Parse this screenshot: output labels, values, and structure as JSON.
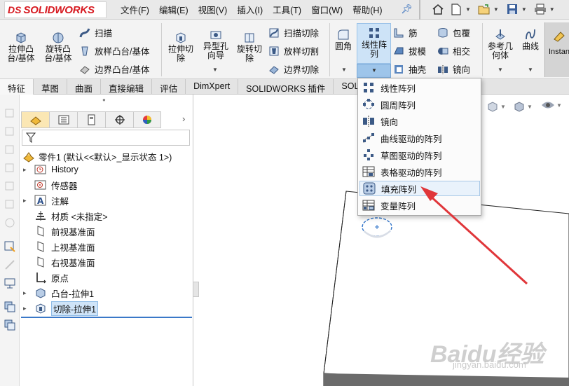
{
  "app": {
    "logo_text": "SOLIDWORKS",
    "logo_mark": "DS"
  },
  "menu": [
    "文件(F)",
    "编辑(E)",
    "视图(V)",
    "插入(I)",
    "工具(T)",
    "窗口(W)",
    "帮助(H)"
  ],
  "ribbon": {
    "extrude_boss": "拉伸凸\n台/基体",
    "revolve_boss": "旋转凸\n台/基体",
    "sweep": "扫描",
    "loft_boss": "放样凸台/基体",
    "boundary_boss": "边界凸台/基体",
    "extrude_cut": "拉伸切\n除",
    "hole_wizard": "异型孔\n向导",
    "revolve_cut": "旋转切\n除",
    "swept_cut": "扫描切除",
    "lofted_cut": "放样切割",
    "boundary_cut": "边界切除",
    "fillet": "圆角",
    "linear_pattern": "线性阵\n列",
    "rib": "筋",
    "draft": "拔模",
    "shell": "抽壳",
    "wrap": "包覆",
    "intersect": "相交",
    "mirror": "镜向",
    "ref_geometry": "参考几\n何体",
    "curves": "曲线",
    "instant3d": "Instant"
  },
  "tabs": [
    "特征",
    "草图",
    "曲面",
    "直接编辑",
    "评估",
    "DimXpert",
    "SOLIDWORKS 插件",
    "SOLID"
  ],
  "feature_tree": {
    "root": "零件1 (默认<<默认>_显示状态 1>)",
    "items": [
      {
        "label": "History",
        "expand": "▸",
        "icon": "history-icon"
      },
      {
        "label": "传感器",
        "expand": "",
        "icon": "sensor-icon"
      },
      {
        "label": "注解",
        "expand": "▸",
        "icon": "annotation-icon"
      },
      {
        "label": "材质 <未指定>",
        "expand": "",
        "icon": "material-icon"
      },
      {
        "label": "前视基准面",
        "expand": "",
        "icon": "plane-icon"
      },
      {
        "label": "上视基准面",
        "expand": "",
        "icon": "plane-icon"
      },
      {
        "label": "右视基准面",
        "expand": "",
        "icon": "plane-icon"
      },
      {
        "label": "原点",
        "expand": "",
        "icon": "origin-icon"
      },
      {
        "label": "凸台-拉伸1",
        "expand": "▸",
        "icon": "boss-extrude-icon"
      },
      {
        "label": "切除-拉伸1",
        "expand": "▸",
        "icon": "cut-extrude-icon"
      }
    ]
  },
  "pattern_menu": [
    {
      "label": "线性阵列",
      "icon": "linear-pattern-icon"
    },
    {
      "label": "圆周阵列",
      "icon": "circular-pattern-icon"
    },
    {
      "label": "镜向",
      "icon": "mirror-icon"
    },
    {
      "label": "曲线驱动的阵列",
      "icon": "curve-pattern-icon"
    },
    {
      "label": "草图驱动的阵列",
      "icon": "sketch-pattern-icon"
    },
    {
      "label": "表格驱动的阵列",
      "icon": "table-pattern-icon"
    },
    {
      "label": "填充阵列",
      "icon": "fill-pattern-icon"
    },
    {
      "label": "变量阵列",
      "icon": "variable-pattern-icon"
    }
  ],
  "colors": {
    "accent": "#2f73c9",
    "arrow": "#e0363a",
    "brand": "#d71920"
  },
  "watermark": {
    "text": "Baidu经验",
    "sub": "jingyan.baidu.com"
  }
}
